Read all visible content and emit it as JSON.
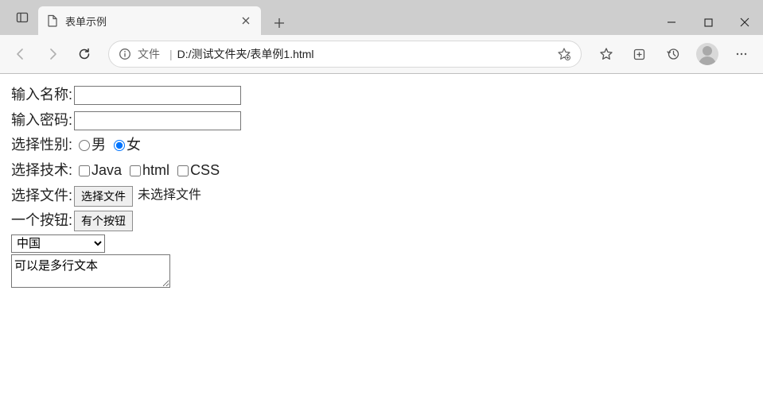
{
  "browser": {
    "tab_title": "表单示例",
    "address_scheme": "文件",
    "address_path": "D:/测试文件夹/表单例1.html",
    "file_picker_no_file": "未选择文件"
  },
  "form": {
    "name_label": "输入名称:",
    "name_value": "",
    "password_label": "输入密码:",
    "password_value": "",
    "gender_label": "选择性别:",
    "gender_options": {
      "male": "男",
      "female": "女"
    },
    "gender_selected": "female",
    "tech_label": "选择技术:",
    "tech_options": {
      "java": "Java",
      "html": "html",
      "css": "CSS"
    },
    "file_label": "选择文件:",
    "file_button": "选择文件",
    "button_label": "一个按钮:",
    "button_text": "有个按钮",
    "select_selected": "中国",
    "select_options": [
      "中国"
    ],
    "textarea_value": "可以是多行文本"
  }
}
